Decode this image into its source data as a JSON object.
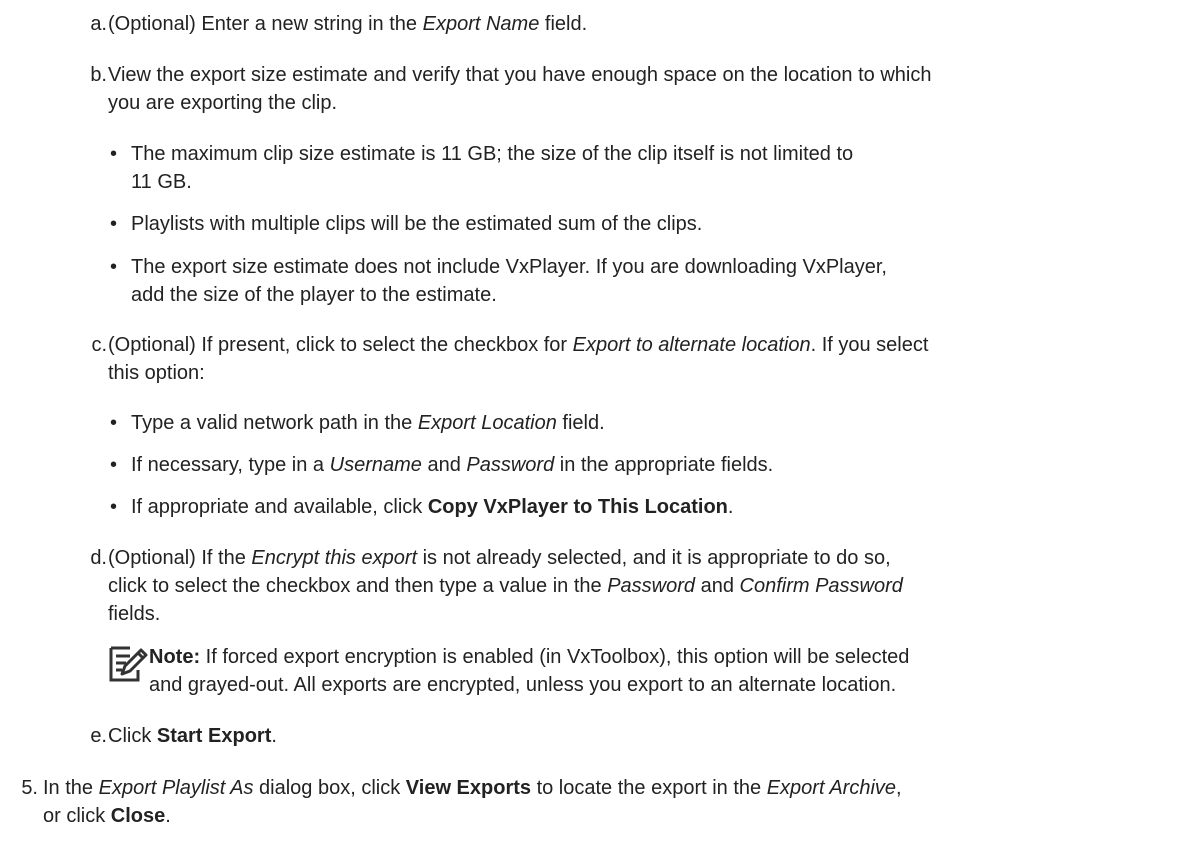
{
  "steps": {
    "a": {
      "marker": "a.",
      "pre": "(Optional) Enter a new string in the ",
      "em": "Export Name",
      "post": " field."
    },
    "b": {
      "marker": "b.",
      "line1": "View the export size estimate and verify that you have enough space on the location to which",
      "line2": "you are exporting the clip.",
      "bullets": [
        {
          "line1": "The maximum clip size estimate is 11 GB; the size of the clip itself is not limited to",
          "line2": "11 GB."
        },
        {
          "line1": "Playlists with multiple clips will be the estimated sum of the clips."
        },
        {
          "line1": "The export size estimate does not include VxPlayer. If you are downloading VxPlayer,",
          "line2": "add the size of the player to the estimate."
        }
      ]
    },
    "c": {
      "marker": "c.",
      "pre": "(Optional) If present, click to select the checkbox for ",
      "em": "Export to alternate location",
      "post": ". If you select",
      "line2": "this option:",
      "bullets": {
        "b1": {
          "pre": "Type a valid network path in the ",
          "em": "Export Location",
          "post": " field."
        },
        "b2": {
          "pre": "If necessary, type in a ",
          "em1": "Username",
          "mid": " and ",
          "em2": "Password",
          "post": " in the appropriate fields."
        },
        "b3": {
          "pre": "If appropriate and available, click ",
          "strong": "Copy VxPlayer to This Location",
          "post": "."
        }
      }
    },
    "d": {
      "marker": "d.",
      "pre": "(Optional) If the ",
      "em": "Encrypt this export",
      "post": " is not already selected, and it is appropriate to do so,",
      "line2_pre": "click to select the checkbox and then type a value in the ",
      "line2_em1": "Password",
      "line2_mid": " and ",
      "line2_em2": "Confirm Password",
      "line3": "fields.",
      "note": {
        "label": "Note:",
        "line1": " If forced export encryption is enabled (in VxToolbox), this option will be selected",
        "line2": "and grayed-out. All exports are encrypted, unless you export to an alternate location."
      }
    },
    "e": {
      "marker": "e.",
      "pre": "Click ",
      "strong": "Start Export",
      "post": "."
    }
  },
  "step5": {
    "marker": "5.",
    "pre": "In the ",
    "em1": "Export Playlist As",
    "mid1": " dialog box, click ",
    "strong1": "View Exports",
    "mid2": " to locate the export in the ",
    "em2": "Export Archive",
    "post": ",",
    "line2_pre": "or click ",
    "line2_strong": "Close",
    "line2_post": "."
  },
  "bullet_char": "•",
  "icons": {
    "note": "note-pencil-icon"
  }
}
